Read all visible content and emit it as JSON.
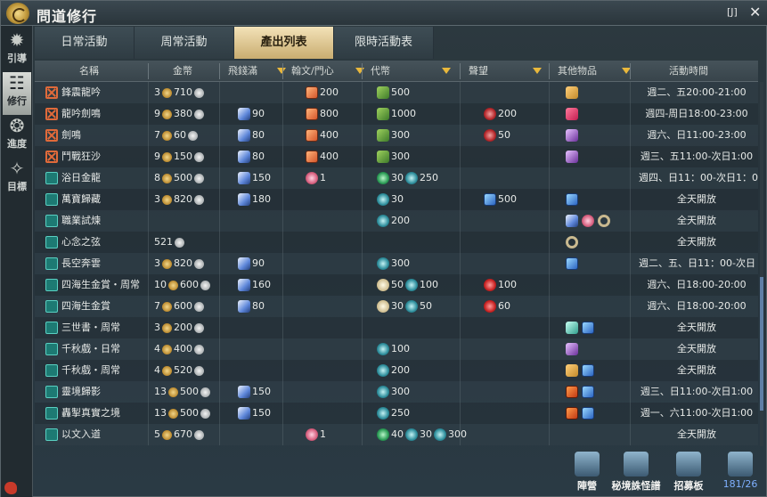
{
  "window": {
    "title": "問道修行",
    "hotkey": "[J]",
    "close": "✕"
  },
  "sidebar": [
    {
      "label": "引導",
      "icon": "compass-star-icon",
      "active": false
    },
    {
      "label": "修行",
      "icon": "scroll-icon",
      "active": true
    },
    {
      "label": "進度",
      "icon": "swirl-icon",
      "active": false
    },
    {
      "label": "目標",
      "icon": "target-icon",
      "active": false
    }
  ],
  "tabs": [
    "日常活動",
    "周常活動",
    "產出列表",
    "限時活動表"
  ],
  "active_tab": 2,
  "columns": [
    "名稱",
    "金幣",
    "飛錢滿",
    "翰文/門心",
    "代幣",
    "聲望",
    "其他物品",
    "活動時間"
  ],
  "rows": [
    {
      "kind": "pvp",
      "name": "鋒震龍吟",
      "gold": "3",
      "silver": "710",
      "fly": "",
      "han": "200",
      "daibi": [
        {
          "icon": "leaf",
          "val": "500"
        }
      ],
      "rep": "",
      "other": [
        "bottle"
      ],
      "time": "週二、五20:00-21:00"
    },
    {
      "kind": "pvp",
      "name": "龍吟劍鳴",
      "gold": "9",
      "silver": "380",
      "fly": "90",
      "han": "800",
      "daibi": [
        {
          "icon": "leaf",
          "val": "1000"
        }
      ],
      "rep": "200",
      "other": [
        "gem"
      ],
      "time": "週四-周日18:00-23:00"
    },
    {
      "kind": "pvp",
      "name": "劍鳴",
      "gold": "7",
      "silver": "60",
      "fly": "80",
      "han": "400",
      "daibi": [
        {
          "icon": "leaf",
          "val": "300"
        }
      ],
      "rep": "50",
      "other": [
        "book"
      ],
      "time": "週六、日11:00-23:00"
    },
    {
      "kind": "pvp",
      "name": "鬥戰狂沙",
      "gold": "9",
      "silver": "150",
      "fly": "80",
      "han": "400",
      "daibi": [
        {
          "icon": "leaf",
          "val": "300"
        }
      ],
      "rep": "",
      "other": [
        "book"
      ],
      "time": "週三、五11:00-次日1:00"
    },
    {
      "kind": "pve",
      "name": "浴日金龍",
      "gold": "8",
      "silver": "500",
      "fly": "150",
      "han": "1",
      "hanIcon": "pink",
      "daibi": [
        {
          "icon": "drop",
          "val": "30"
        },
        {
          "icon": "bluecoin",
          "val": "250"
        }
      ],
      "rep": "",
      "other": [],
      "time": "週四、日11：00-次日1：0"
    },
    {
      "kind": "pve",
      "name": "萬寶歸藏",
      "gold": "3",
      "silver": "820",
      "fly": "180",
      "han": "",
      "daibi": [
        {
          "icon": "bluecoin",
          "val": "30"
        }
      ],
      "rep": "500",
      "repIcon": "box",
      "other": [
        "box"
      ],
      "time": "全天開放"
    },
    {
      "kind": "pve",
      "name": "職業試煉",
      "gold": "",
      "silver": "",
      "fly": "",
      "han": "",
      "daibi": [
        {
          "icon": "bluecoin",
          "val": "200"
        }
      ],
      "rep": "",
      "other": [
        "feather",
        "pink",
        "ring"
      ],
      "time": "全天開放"
    },
    {
      "kind": "pve",
      "name": "心念之弦",
      "gold": "",
      "silver": "521",
      "fly": "",
      "han": "",
      "daibi": [],
      "rep": "",
      "other": [
        "ring"
      ],
      "time": "全天開放"
    },
    {
      "kind": "pve",
      "name": "長空奔雲",
      "gold": "3",
      "silver": "820",
      "fly": "90",
      "han": "",
      "daibi": [
        {
          "icon": "bluecoin",
          "val": "300"
        }
      ],
      "rep": "",
      "other": [
        "box"
      ],
      "time": "週二、五、日11：00-次日"
    },
    {
      "kind": "pve",
      "name": "四海生金賞・周常",
      "gold": "10",
      "silver": "600",
      "fly": "160",
      "han": "",
      "daibi": [
        {
          "icon": "compass",
          "val": "50"
        },
        {
          "icon": "bluecoin",
          "val": "100"
        }
      ],
      "rep": "100",
      "repIcon": "red",
      "other": [],
      "time": "週六、日18:00-20:00"
    },
    {
      "kind": "pve",
      "name": "四海生金賞",
      "gold": "7",
      "silver": "600",
      "fly": "80",
      "han": "",
      "daibi": [
        {
          "icon": "compass",
          "val": "30"
        },
        {
          "icon": "bluecoin",
          "val": "50"
        }
      ],
      "rep": "60",
      "repIcon": "red",
      "other": [],
      "time": "週六、日18:00-20:00"
    },
    {
      "kind": "pve",
      "name": "三世書・周常",
      "gold": "3",
      "silver": "200",
      "fly": "",
      "han": "",
      "daibi": [],
      "rep": "",
      "other": [
        "teal",
        "box"
      ],
      "time": "全天開放"
    },
    {
      "kind": "pve",
      "name": "千秋戲・日常",
      "gold": "4",
      "silver": "400",
      "fly": "",
      "han": "",
      "daibi": [
        {
          "icon": "bluecoin",
          "val": "100"
        }
      ],
      "rep": "",
      "other": [
        "book"
      ],
      "time": "全天開放"
    },
    {
      "kind": "pve",
      "name": "千秋戲・周常",
      "gold": "4",
      "silver": "520",
      "fly": "",
      "han": "",
      "daibi": [
        {
          "icon": "bluecoin",
          "val": "200"
        }
      ],
      "rep": "",
      "other": [
        "bottle",
        "box"
      ],
      "time": "全天開放"
    },
    {
      "kind": "pve",
      "name": "靈境歸影",
      "gold": "13",
      "silver": "500",
      "fly": "150",
      "han": "",
      "daibi": [
        {
          "icon": "bluecoin",
          "val": "300"
        }
      ],
      "rep": "",
      "other": [
        "chest",
        "box"
      ],
      "time": "週三、日11:00-次日1:00"
    },
    {
      "kind": "pve",
      "name": "轟掣真實之境",
      "gold": "13",
      "silver": "500",
      "fly": "150",
      "han": "",
      "daibi": [
        {
          "icon": "bluecoin",
          "val": "250"
        }
      ],
      "rep": "",
      "other": [
        "chest",
        "box"
      ],
      "time": "週一、六11:00-次日1:00"
    },
    {
      "kind": "pve",
      "name": "以文入道",
      "gold": "5",
      "silver": "670",
      "fly": "",
      "han": "1",
      "hanIcon": "pink",
      "daibi": [
        {
          "icon": "drop",
          "val": "40"
        },
        {
          "icon": "bluecoin",
          "val": "30"
        },
        {
          "icon": "bluecoin",
          "val": "300"
        }
      ],
      "rep": "",
      "other": [],
      "time": "全天開放"
    }
  ],
  "bottom": [
    {
      "label": "陣營",
      "icon": "crossed-swords-icon"
    },
    {
      "label": "秘境誅怪譜",
      "icon": "shrine-icon"
    },
    {
      "label": "招募板",
      "icon": "board-icon"
    },
    {
      "label": "181/26",
      "icon": "sword-icon",
      "count_current": "181",
      "count_total": "26"
    }
  ]
}
